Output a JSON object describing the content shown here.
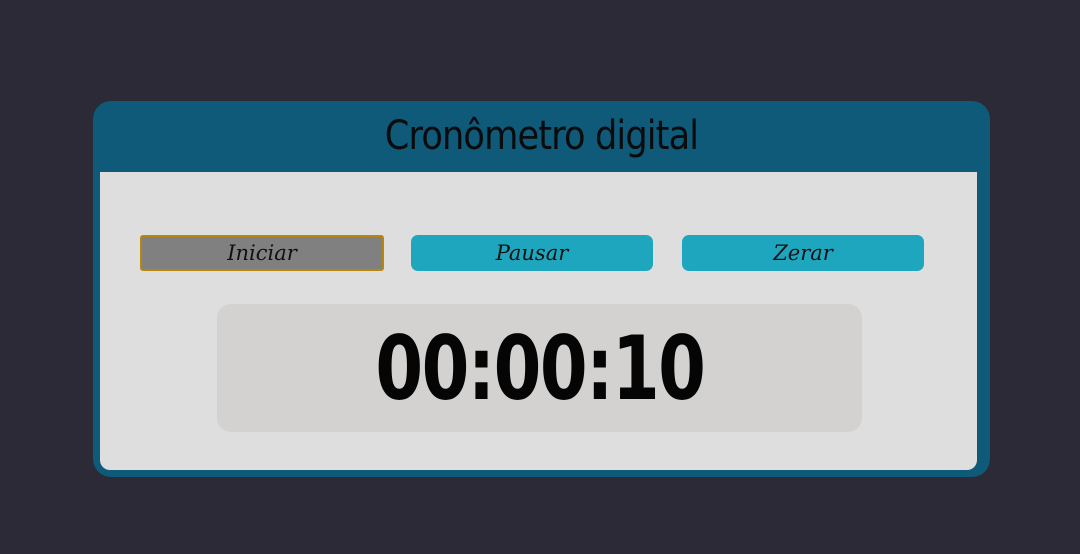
{
  "app": {
    "title": "Cronômetro digital"
  },
  "controls": {
    "start_label": "Iniciar",
    "pause_label": "Pausar",
    "reset_label": "Zerar"
  },
  "display": {
    "time": "00:00:10"
  },
  "colors": {
    "background": "#2b2a36",
    "header": "#0e5a78",
    "panel": "#dedede",
    "button_accent": "#1fa6bf",
    "button_active": "#808080",
    "display_bg": "#d3d2d0"
  }
}
